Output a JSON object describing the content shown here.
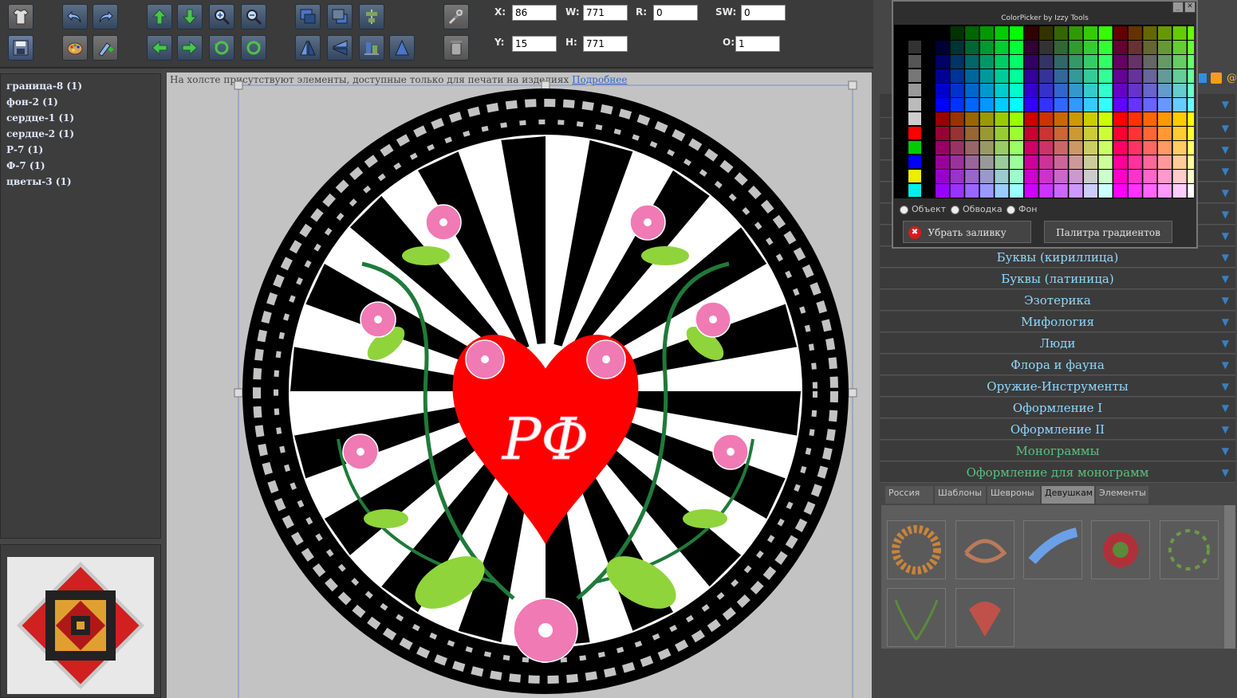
{
  "toolbar": {
    "fields": {
      "x": {
        "label": "X:",
        "value": "86"
      },
      "w": {
        "label": "W:",
        "value": "771"
      },
      "r": {
        "label": "R:",
        "value": "0"
      },
      "sw": {
        "label": "SW:",
        "value": "0"
      },
      "y": {
        "label": "Y:",
        "value": "15"
      },
      "h": {
        "label": "H:",
        "value": "771"
      },
      "o": {
        "label": "O:",
        "value": "1"
      }
    }
  },
  "layers": {
    "items": [
      "граница-8 (1)",
      "фон-2 (1)",
      "сердце-1 (1)",
      "сердце-2 (1)",
      "Р-7 (1)",
      "Ф-7 (1)",
      "цветы-3 (1)"
    ]
  },
  "canvas": {
    "notice": "На холсте присутствуют элементы, доступные только для печати на изделиях",
    "notice_link": "Подробнее",
    "monogram": "РФ"
  },
  "colorpicker": {
    "title": "ColorPicker by Izzy Tools",
    "radio_object": "Объект",
    "radio_stroke": "Обводка",
    "radio_background": "Фон",
    "remove_fill": "Убрать заливку",
    "gradient_palette": "Палитра градиентов"
  },
  "categories": [
    {
      "label": "Буквы (кириллица)",
      "green": false
    },
    {
      "label": "Буквы (латиница)",
      "green": false
    },
    {
      "label": "Эзотерика",
      "green": false
    },
    {
      "label": "Мифология",
      "green": false
    },
    {
      "label": "Люди",
      "green": false
    },
    {
      "label": "Флора и фауна",
      "green": false
    },
    {
      "label": "Оружие-Инструменты",
      "green": false
    },
    {
      "label": "Оформление I",
      "green": false
    },
    {
      "label": "Оформление II",
      "green": false
    },
    {
      "label": "Монограммы",
      "green": true
    },
    {
      "label": "Оформление для монограмм",
      "green": true
    }
  ],
  "tabs": [
    "Россия",
    "Шаблоны",
    "Шевроны",
    "Девушкам",
    "Элементы"
  ],
  "active_tab": "Девушкам",
  "colors": {
    "accent": "#8fd8ff",
    "green": "#57c27e",
    "heart": "#ff0000"
  }
}
